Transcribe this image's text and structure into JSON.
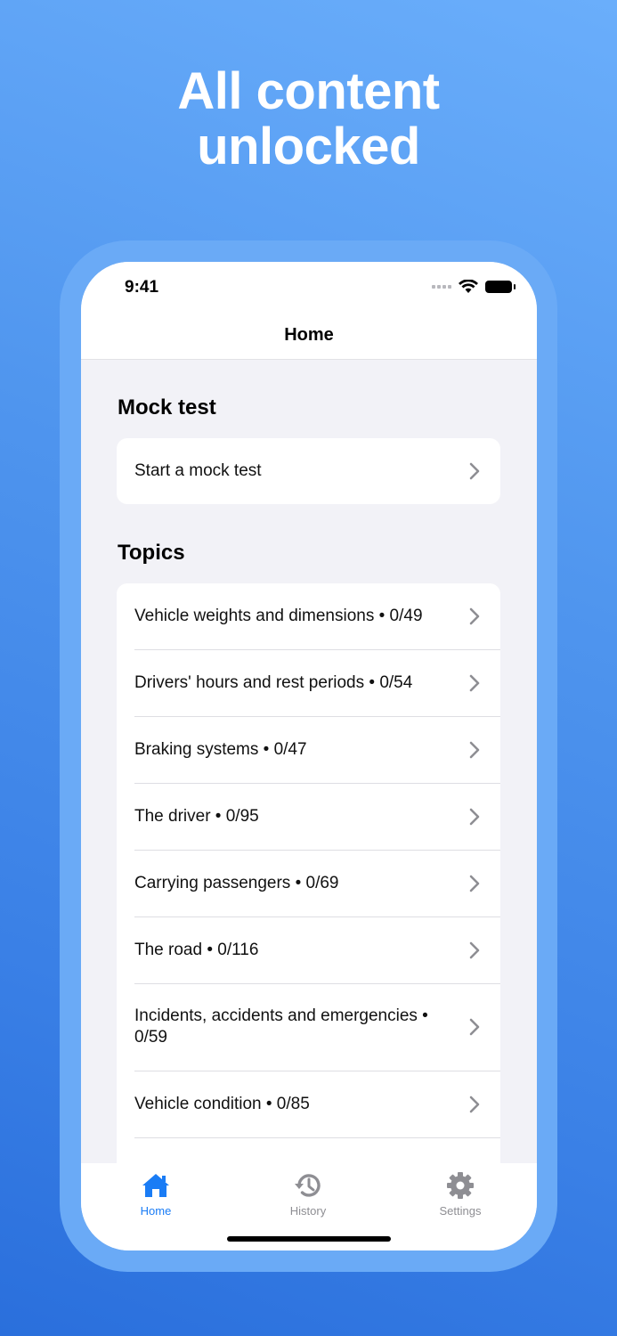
{
  "promo": {
    "headline_line1": "All content",
    "headline_line2": "unlocked"
  },
  "status_bar": {
    "time": "9:41"
  },
  "nav": {
    "title": "Home"
  },
  "mock_test": {
    "section_title": "Mock test",
    "start_label": "Start a mock test"
  },
  "topics": {
    "section_title": "Topics",
    "items": [
      {
        "label": "Vehicle weights and dimensions • 0/49"
      },
      {
        "label": "Drivers' hours and rest periods • 0/54"
      },
      {
        "label": "Braking systems • 0/47"
      },
      {
        "label": "The driver • 0/95"
      },
      {
        "label": "Carrying passengers • 0/69"
      },
      {
        "label": "The road • 0/116"
      },
      {
        "label": "Incidents, accidents and emergencies • 0/59"
      },
      {
        "label": "Vehicle condition • 0/85"
      }
    ]
  },
  "tab_bar": {
    "tabs": [
      {
        "label": "Home",
        "icon": "house-icon",
        "active": true
      },
      {
        "label": "History",
        "icon": "history-clock-icon",
        "active": false
      },
      {
        "label": "Settings",
        "icon": "gear-icon",
        "active": false
      }
    ]
  },
  "colors": {
    "accent": "#1a7cf5",
    "inactive": "#8e8e93",
    "background_top": "#6aaefb",
    "background_bottom": "#2a6fdc"
  }
}
